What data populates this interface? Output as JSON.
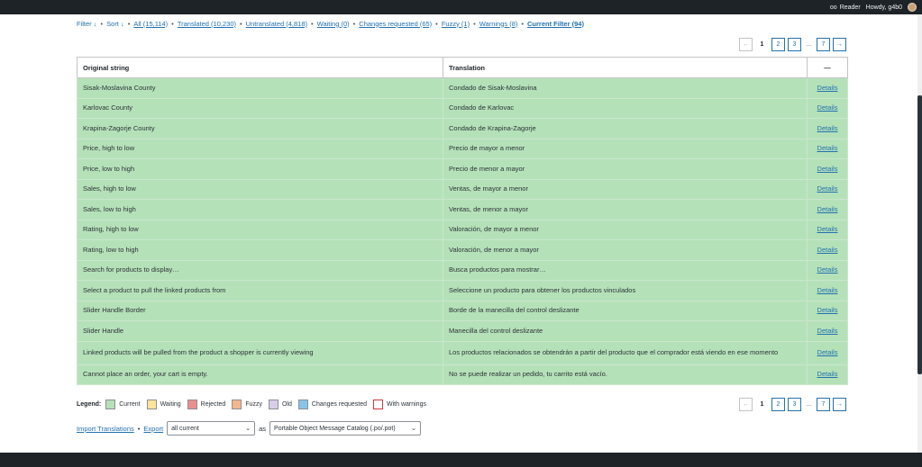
{
  "topbar": {
    "reader_label": "Reader",
    "howdy": "Howdy, g4b0"
  },
  "filters": {
    "filter_label": "Filter ↓",
    "sort_label": "Sort ↓",
    "tabs": [
      {
        "label": "All (15,114)"
      },
      {
        "label": "Translated (10,230)"
      },
      {
        "label": "Untranslated (4,818)"
      },
      {
        "label": "Waiting (0)"
      },
      {
        "label": "Changes requested (65)"
      },
      {
        "label": "Fuzzy (1)"
      },
      {
        "label": "Warnings (8)"
      },
      {
        "label": "Current Filter (94)"
      }
    ]
  },
  "pagination": {
    "prev": "←",
    "current": "1",
    "page2": "2",
    "page3": "3",
    "ellipsis": "…",
    "last": "7",
    "next": "→"
  },
  "table": {
    "headers": {
      "original": "Original string",
      "translation": "Translation",
      "actions": "—"
    },
    "rows": [
      {
        "original": "Sisak-Moslavina County",
        "translation": "Condado de Sisak-Moslavina",
        "action": "Details"
      },
      {
        "original": "Karlovac County",
        "translation": "Condado de Karlovac",
        "action": "Details"
      },
      {
        "original": "Krapina-Zagorje County",
        "translation": "Condado de Krapina-Zagorje",
        "action": "Details"
      },
      {
        "original": "Price, high to low",
        "translation": "Precio de mayor a menor",
        "action": "Details"
      },
      {
        "original": "Price, low to high",
        "translation": "Precio de menor a mayor",
        "action": "Details"
      },
      {
        "original": "Sales, high to low",
        "translation": "Ventas, de mayor a menor",
        "action": "Details"
      },
      {
        "original": "Sales, low to high",
        "translation": "Ventas, de menor a mayor",
        "action": "Details"
      },
      {
        "original": "Rating, high to low",
        "translation": "Valoración, de mayor a menor",
        "action": "Details"
      },
      {
        "original": "Rating, low to high",
        "translation": "Valoración, de menor a mayor",
        "action": "Details"
      },
      {
        "original": "Search for products to display…",
        "translation": "Busca productos para mostrar…",
        "action": "Details"
      },
      {
        "original": "Select a product to pull the linked products from",
        "translation": "Seleccione un producto para obtener los productos vinculados",
        "action": "Details"
      },
      {
        "original": "Slider Handle Border",
        "translation": "Borde de la manecilla del control deslizante",
        "action": "Details"
      },
      {
        "original": "Slider Handle",
        "translation": "Manecilla del control deslizante",
        "action": "Details"
      },
      {
        "original": "Linked products will be pulled from the product a shopper is currently viewing",
        "translation": "Los productos relacionados se obtendrán a partir del producto que el comprador está viendo en ese momento",
        "action": "Details"
      },
      {
        "original": "Cannot place an order, your cart is empty.",
        "translation": "No se puede realizar un pedido, tu carrito está vacío.",
        "action": "Details"
      }
    ]
  },
  "legend": {
    "title": "Legend:",
    "items": [
      {
        "label": "Current",
        "color": "#b5e1b9"
      },
      {
        "label": "Waiting",
        "color": "#ffe399"
      },
      {
        "label": "Rejected",
        "color": "#ec8e8e"
      },
      {
        "label": "Fuzzy",
        "color": "#f7b58c"
      },
      {
        "label": "Old",
        "color": "#d8cde7"
      },
      {
        "label": "Changes requested",
        "color": "#87c5e8"
      },
      {
        "label": "With warnings",
        "color": "#ffffff"
      }
    ]
  },
  "bottom": {
    "import_label": "Import Translations",
    "export_label": "Export",
    "export_which": "all current",
    "as_label": "as",
    "export_format": "Portable Object Message Catalog (.po/.pot)"
  }
}
